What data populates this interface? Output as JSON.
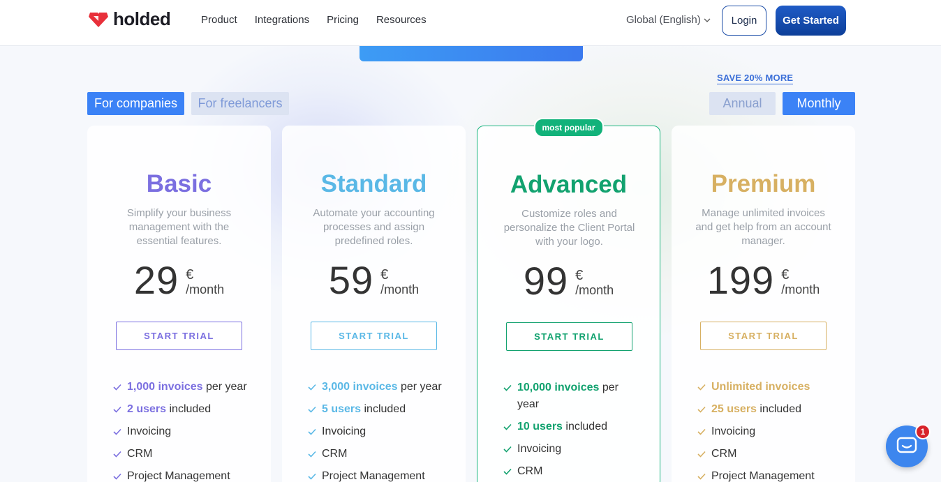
{
  "header": {
    "logo_text": "holded",
    "nav": [
      "Product",
      "Integrations",
      "Pricing",
      "Resources"
    ],
    "language": "Global (English)",
    "login": "Login",
    "get_started": "Get Started"
  },
  "audience_toggle": {
    "companies": "For companies",
    "freelancers": "For freelancers",
    "selected": "For companies"
  },
  "billing_toggle": {
    "save_note": "SAVE 20% MORE",
    "annual": "Annual",
    "monthly": "Monthly",
    "selected": "Monthly"
  },
  "colors": {
    "basic": "#7b6fe0",
    "standard": "#5ab8e6",
    "advanced": "#12a26f",
    "premium": "#d7b062",
    "primary": "#3b82f6"
  },
  "plans": [
    {
      "name": "Basic",
      "description": "Simplify your business management with the essential features.",
      "price": "29",
      "currency": "€",
      "period": "/month",
      "cta": "START TRIAL",
      "features": [
        {
          "highlight": "1,000 invoices",
          "rest": " per year"
        },
        {
          "highlight": "2 users",
          "rest": " included"
        },
        {
          "highlight": "",
          "rest": "Invoicing"
        },
        {
          "highlight": "",
          "rest": "CRM"
        },
        {
          "highlight": "",
          "rest": "Project Management"
        }
      ]
    },
    {
      "name": "Standard",
      "description": "Automate your accounting processes and assign predefined roles.",
      "price": "59",
      "currency": "€",
      "period": "/month",
      "cta": "START TRIAL",
      "features": [
        {
          "highlight": "3,000 invoices",
          "rest": " per year"
        },
        {
          "highlight": "5 users",
          "rest": " included"
        },
        {
          "highlight": "",
          "rest": "Invoicing"
        },
        {
          "highlight": "",
          "rest": "CRM"
        },
        {
          "highlight": "",
          "rest": "Project Management"
        }
      ]
    },
    {
      "name": "Advanced",
      "badge": "most popular",
      "description": "Customize roles and personalize the Client Portal with your logo.",
      "price": "99",
      "currency": "€",
      "period": "/month",
      "cta": "START TRIAL",
      "features": [
        {
          "highlight": "10,000 invoices",
          "rest": " per year"
        },
        {
          "highlight": "10 users",
          "rest": " included"
        },
        {
          "highlight": "",
          "rest": "Invoicing"
        },
        {
          "highlight": "",
          "rest": "CRM"
        }
      ]
    },
    {
      "name": "Premium",
      "description": "Manage unlimited invoices and get help from an account manager.",
      "price": "199",
      "currency": "€",
      "period": "/month",
      "cta": "START TRIAL",
      "features": [
        {
          "highlight": "Unlimited invoices",
          "rest": ""
        },
        {
          "highlight": "25 users",
          "rest": " included"
        },
        {
          "highlight": "",
          "rest": "Invoicing"
        },
        {
          "highlight": "",
          "rest": "CRM"
        },
        {
          "highlight": "",
          "rest": "Project Management"
        }
      ]
    }
  ],
  "chat": {
    "icon": "chat-bubble-icon",
    "unread": "1"
  }
}
